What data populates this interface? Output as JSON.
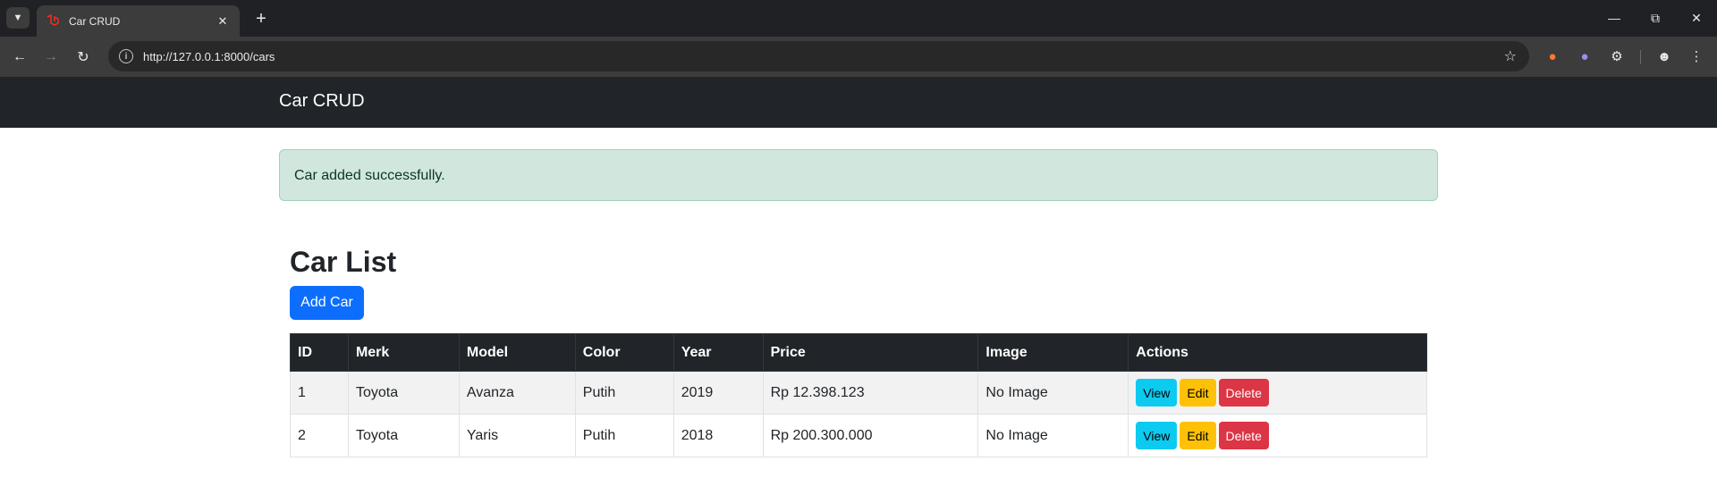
{
  "browser": {
    "tab_title": "Car CRUD",
    "url": "http://127.0.0.1:8000/cars",
    "accent": "#3c3c3c"
  },
  "navbar": {
    "brand": "Car CRUD"
  },
  "alert": {
    "message": "Car added successfully.",
    "color": "#d1e7dd"
  },
  "main": {
    "heading": "Car List",
    "add_button": "Add Car",
    "columns": [
      "ID",
      "Merk",
      "Model",
      "Color",
      "Year",
      "Price",
      "Image",
      "Actions"
    ],
    "rows": [
      {
        "id": "1",
        "merk": "Toyota",
        "model": "Avanza",
        "color": "Putih",
        "year": "2019",
        "price": "Rp 12.398.123",
        "image": "No Image"
      },
      {
        "id": "2",
        "merk": "Toyota",
        "model": "Yaris",
        "color": "Putih",
        "year": "2018",
        "price": "Rp 200.300.000",
        "image": "No Image"
      }
    ],
    "actions": {
      "view": "View",
      "edit": "Edit",
      "delete": "Delete"
    }
  },
  "colors": {
    "primary": "#0d6efd",
    "info": "#0dcaf0",
    "warning": "#ffc107",
    "danger": "#dc3545",
    "dark": "#212529"
  }
}
